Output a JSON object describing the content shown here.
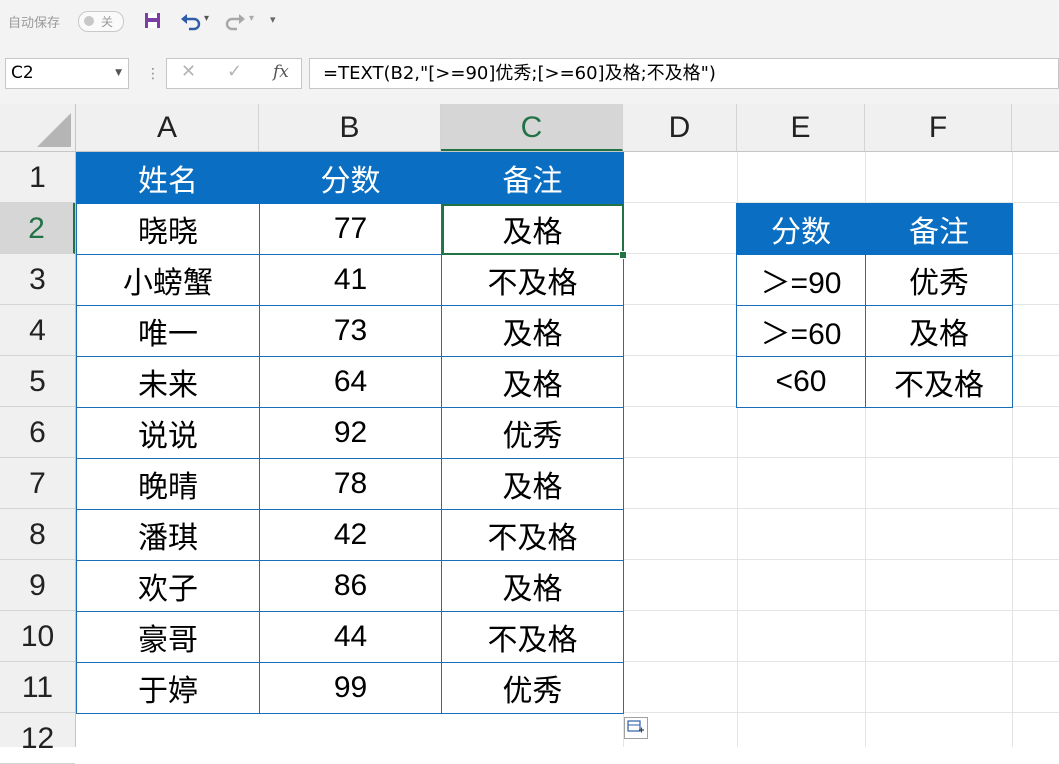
{
  "toolbar": {
    "autosave_label": "自动保存",
    "autosave_state": "关"
  },
  "formula_bar": {
    "name_box": "C2",
    "formula": "=TEXT(B2,\"[>=90]优秀;[>=60]及格;不及格\")",
    "fx_label": "fx"
  },
  "columns": [
    "A",
    "B",
    "C",
    "D",
    "E",
    "F"
  ],
  "rows": [
    "1",
    "2",
    "3",
    "4",
    "5",
    "6",
    "7",
    "8",
    "9",
    "10",
    "11",
    "12"
  ],
  "selected_cell": "C2",
  "main_table": {
    "headers": [
      "姓名",
      "分数",
      "备注"
    ],
    "rows": [
      [
        "晓晓",
        "77",
        "及格"
      ],
      [
        "小螃蟹",
        "41",
        "不及格"
      ],
      [
        "唯一",
        "73",
        "及格"
      ],
      [
        "未来",
        "64",
        "及格"
      ],
      [
        "说说",
        "92",
        "优秀"
      ],
      [
        "晚晴",
        "78",
        "及格"
      ],
      [
        "潘琪",
        "42",
        "不及格"
      ],
      [
        "欢子",
        "86",
        "及格"
      ],
      [
        "豪哥",
        "44",
        "不及格"
      ],
      [
        "于婷",
        "99",
        "优秀"
      ]
    ]
  },
  "lookup_table": {
    "headers": [
      "分数",
      "备注"
    ],
    "rows": [
      [
        "＞=90",
        "优秀"
      ],
      [
        "＞=60",
        "及格"
      ],
      [
        "<60",
        "不及格"
      ]
    ]
  },
  "colors": {
    "header_fill": "#0a6fc2",
    "selection": "#217346"
  }
}
